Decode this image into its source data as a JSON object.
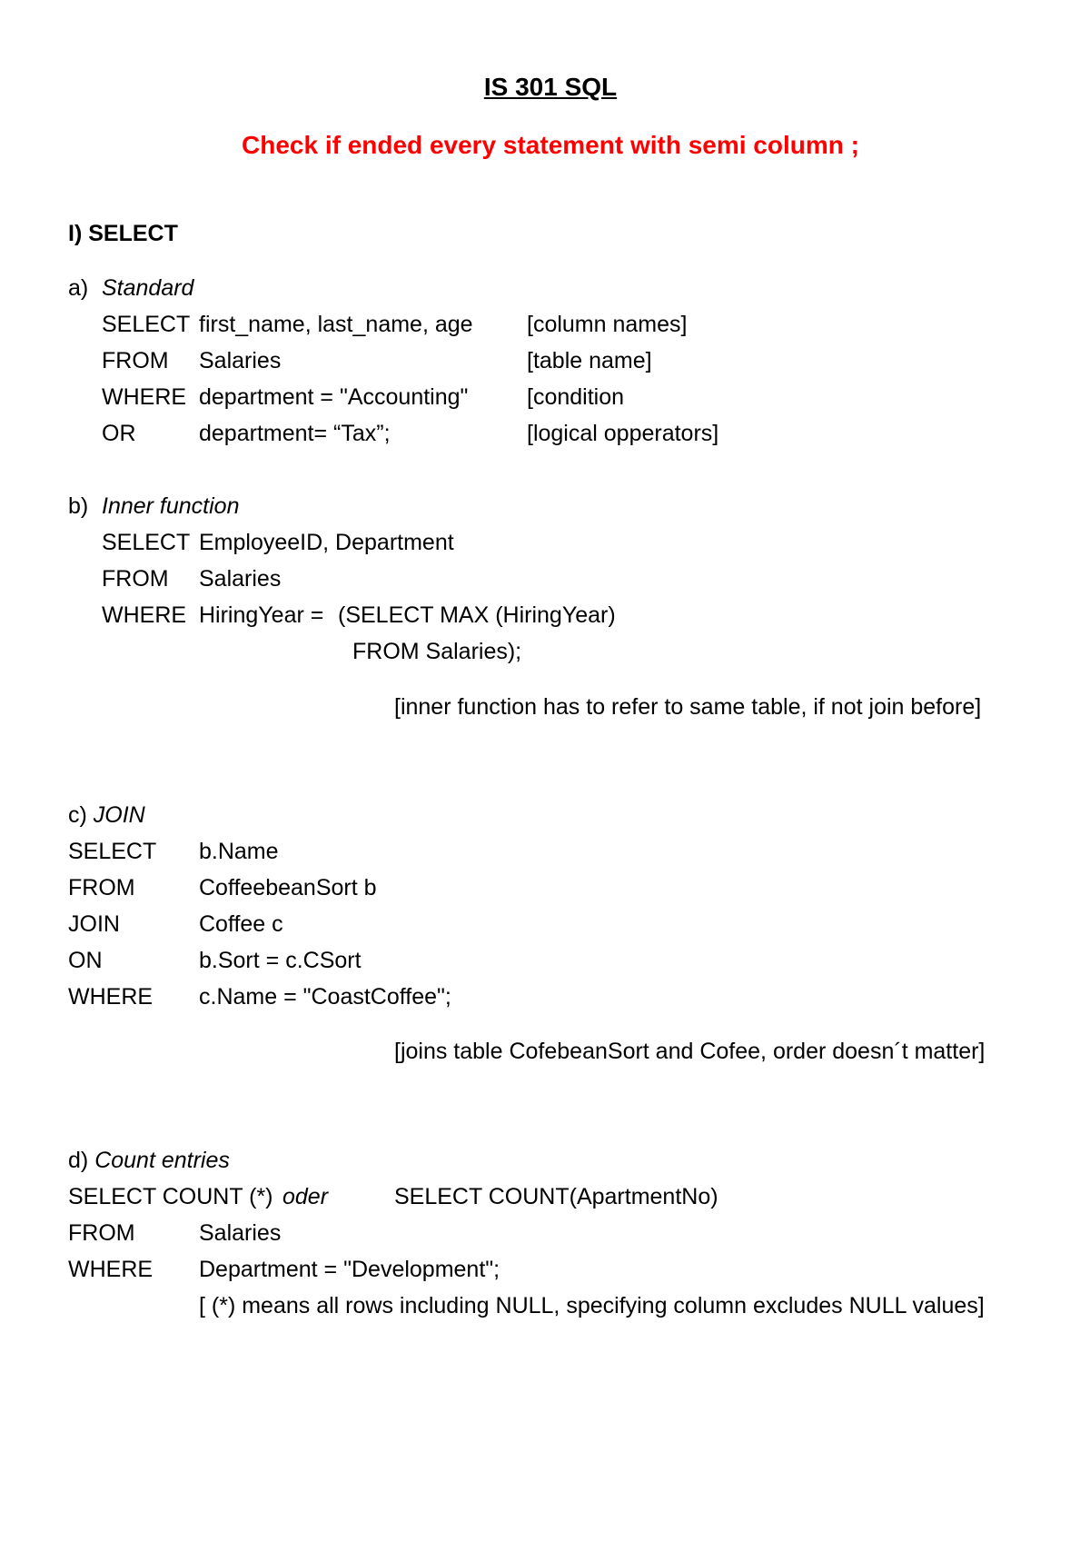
{
  "document": {
    "title": "IS 301 SQL",
    "warning": "Check if ended every statement with semi column ;",
    "warning_color": "#ff0000",
    "section": "I) SELECT",
    "parts": {
      "a": {
        "marker": "a)",
        "heading": "Standard",
        "lines": [
          {
            "keyword": "SELECT",
            "expr": "first_name, last_name, age",
            "note": "[column names]"
          },
          {
            "keyword": "FROM",
            "expr": "Salaries",
            "note": "[table name]"
          },
          {
            "keyword": "WHERE",
            "expr": "department = \"Accounting\"",
            "note": "[condition"
          },
          {
            "keyword": "OR",
            "expr": "department= “Tax”;",
            "note": "[logical opperators]"
          }
        ]
      },
      "b": {
        "marker": "b)",
        "heading": "Inner function",
        "lines": [
          {
            "keyword": "SELECT",
            "expr": "EmployeeID, Department"
          },
          {
            "keyword": "FROM",
            "expr": "Salaries"
          },
          {
            "keyword": "WHERE",
            "expr": "HiringYear =",
            "subquery": "(SELECT MAX (HiringYear)"
          }
        ],
        "subquery_cont": "FROM Salaries);",
        "note": "[inner function has to refer to same table, if not join before]"
      },
      "c": {
        "marker": "c)",
        "heading": "JOIN",
        "lines": [
          {
            "keyword": "SELECT",
            "expr": "b.Name"
          },
          {
            "keyword": "FROM",
            "expr": "CoffeebeanSort b"
          },
          {
            "keyword": "JOIN",
            "expr": "Coffee c"
          },
          {
            "keyword": "ON",
            "expr": "b.Sort = c.CSort"
          },
          {
            "keyword": "WHERE",
            "expr": "c.Name = \"CoastCoffee\";"
          }
        ],
        "note": "[joins table CofebeanSort and Cofee, order doesn´t matter]"
      },
      "d": {
        "marker": "d)",
        "heading": "Count entries",
        "select_a": "SELECT COUNT (*)",
        "oder": "oder",
        "select_b": "SELECT COUNT(ApartmentNo)",
        "lines": [
          {
            "keyword": "FROM",
            "expr": "Salaries"
          },
          {
            "keyword": "WHERE",
            "expr": "Department = \"Development\";"
          }
        ],
        "note": "[ (*) means all rows including NULL, specifying column excludes NULL values]"
      }
    }
  }
}
